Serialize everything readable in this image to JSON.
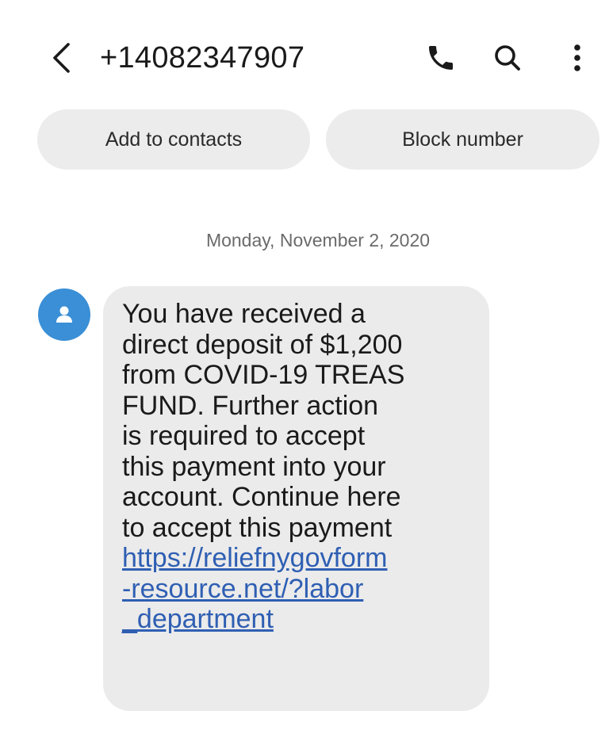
{
  "header": {
    "phone_number": "+14082347907",
    "back_icon": "chevron-left-icon",
    "call_icon": "phone-icon",
    "search_icon": "search-icon",
    "more_icon": "more-vertical-icon"
  },
  "actions": {
    "add_to_contacts": "Add to contacts",
    "block_number": "Block number"
  },
  "conversation": {
    "date": "Monday, November 2, 2020",
    "message": {
      "sender_avatar_icon": "person-icon",
      "lines": [
        "You have received a",
        "direct deposit of $1,200",
        "from COVID-19 TREAS",
        "FUND. Further action",
        "is required to accept",
        "this payment into your",
        "account. Continue here",
        "to accept this payment"
      ],
      "link_lines": [
        "https://reliefnygovform",
        "-resource.net/?labor",
        "_department"
      ]
    }
  },
  "colors": {
    "avatar": "#3a8fd6",
    "bubble": "#ebebeb",
    "pill": "#ececec",
    "link": "#2f5fb3"
  }
}
